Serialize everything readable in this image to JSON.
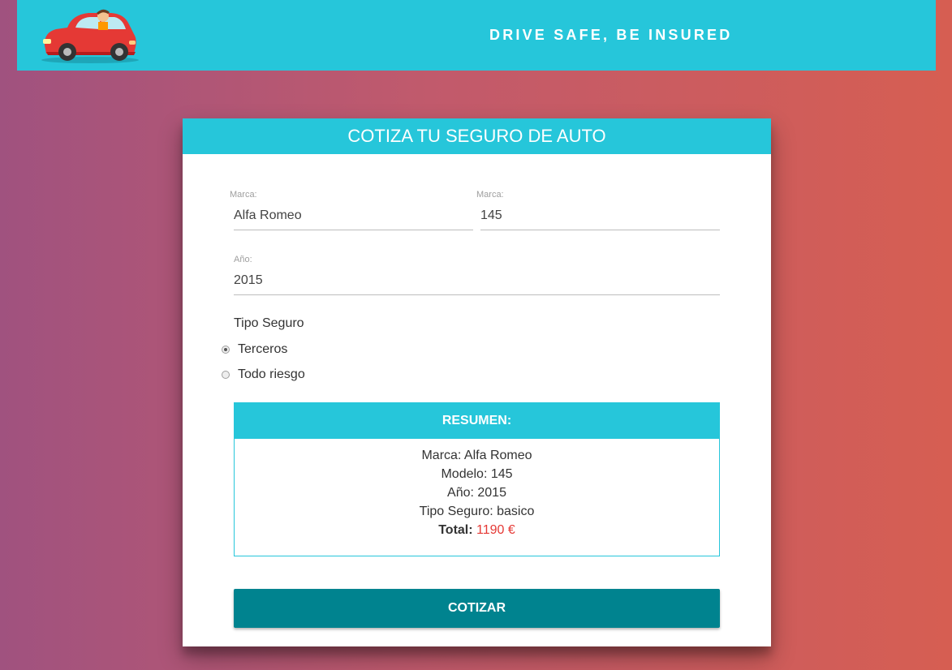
{
  "header": {
    "tagline": "DRIVE SAFE, BE INSURED"
  },
  "form": {
    "title": "COTIZA TU SEGURO DE AUTO",
    "brand": {
      "label": "Marca:",
      "value": "Alfa Romeo"
    },
    "model": {
      "label": "Marca:",
      "value": "145"
    },
    "year": {
      "label": "Año:",
      "value": "2015"
    },
    "insurance_type": {
      "label": "Tipo Seguro",
      "options": [
        {
          "label": "Terceros",
          "checked": true
        },
        {
          "label": "Todo riesgo",
          "checked": false
        }
      ]
    }
  },
  "summary": {
    "title": "RESUMEN:",
    "brand_line": "Marca: Alfa Romeo",
    "model_line": "Modelo: 145",
    "year_line": "Año: 2015",
    "type_line": "Tipo Seguro: basico",
    "total_label": "Total:",
    "total_value": "1190 €"
  },
  "actions": {
    "quote_label": "COTIZAR"
  },
  "colors": {
    "accent": "#26c6da",
    "button": "#00838f",
    "total": "#e53935"
  }
}
